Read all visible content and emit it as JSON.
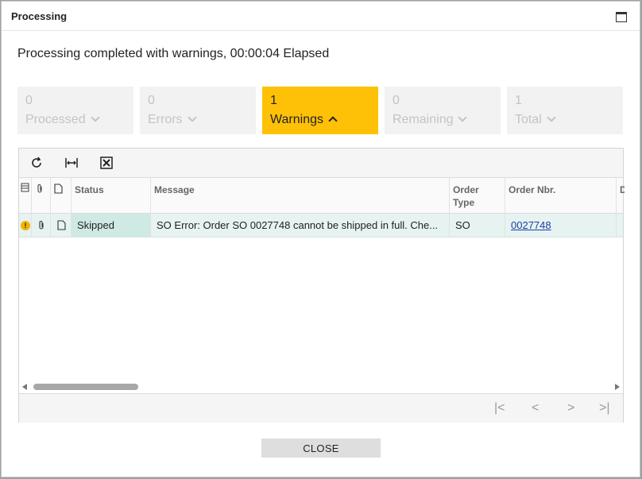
{
  "dialog": {
    "title": "Processing",
    "status_message": "Processing completed with warnings, 00:00:04 Elapsed"
  },
  "tiles": [
    {
      "count": "0",
      "label": "Processed",
      "active": false
    },
    {
      "count": "0",
      "label": "Errors",
      "active": false
    },
    {
      "count": "1",
      "label": "Warnings",
      "active": true
    },
    {
      "count": "0",
      "label": "Remaining",
      "active": false
    },
    {
      "count": "1",
      "label": "Total",
      "active": false
    }
  ],
  "grid": {
    "columns": {
      "status": "Status",
      "message": "Message",
      "order_type": "Order Type",
      "order_nbr": "Order Nbr.",
      "next": "D"
    },
    "rows": [
      {
        "status": "Skipped",
        "message": "SO Error: Order SO 0027748 cannot be shipped in full. Che...",
        "order_type": "SO",
        "order_nbr": "0027748"
      }
    ]
  },
  "pager": {
    "first": "|<",
    "prev": "<",
    "next": ">",
    "last": ">|"
  },
  "close_label": "CLOSE",
  "colors": {
    "accent": "#ffc107",
    "row_highlight": "#e6f3f1",
    "link": "#1a3fa8"
  }
}
